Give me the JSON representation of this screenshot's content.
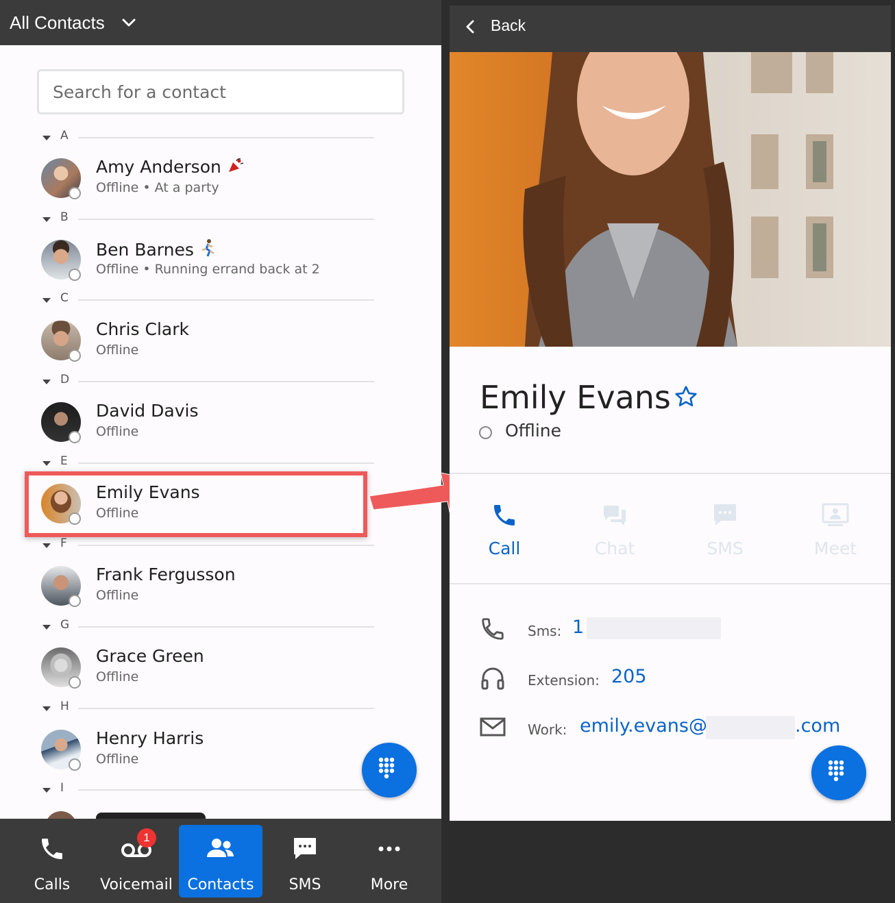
{
  "left_header": {
    "title": "All Contacts"
  },
  "search": {
    "placeholder": "Search for a contact"
  },
  "sections": [
    "A",
    "B",
    "C",
    "D",
    "E",
    "F",
    "G",
    "H",
    "I"
  ],
  "contacts": [
    {
      "name": "Amy Anderson",
      "status": "Offline • At a party",
      "emoji": "party-popper-emoji"
    },
    {
      "name": "Ben Barnes",
      "status": "Offline • Running errand back at 2",
      "emoji": "runner-emoji"
    },
    {
      "name": "Chris Clark",
      "status": "Offline"
    },
    {
      "name": "David Davis",
      "status": "Offline"
    },
    {
      "name": "Emily Evans",
      "status": "Offline"
    },
    {
      "name": "Frank Fergusson",
      "status": "Offline"
    },
    {
      "name": "Grace Green",
      "status": "Offline"
    },
    {
      "name": "Henry Harris",
      "status": "Offline"
    }
  ],
  "bottom_nav": [
    {
      "label": "Calls",
      "icon": "phone-icon"
    },
    {
      "label": "Voicemail",
      "icon": "voicemail-icon",
      "badge": "1"
    },
    {
      "label": "Contacts",
      "icon": "contacts-icon",
      "active": true
    },
    {
      "label": "SMS",
      "icon": "sms-icon"
    },
    {
      "label": "More",
      "icon": "more-icon"
    }
  ],
  "right_header": {
    "back_label": "Back"
  },
  "detail": {
    "name": "Emily Evans",
    "status": "Offline",
    "actions": [
      {
        "label": "Call",
        "enabled": true
      },
      {
        "label": "Chat",
        "enabled": false
      },
      {
        "label": "SMS",
        "enabled": false
      },
      {
        "label": "Meet",
        "enabled": false
      }
    ],
    "sms": {
      "label": "Sms:",
      "value": "1"
    },
    "extension": {
      "label": "Extension:",
      "value": "205"
    },
    "work": {
      "label": "Work:",
      "value_prefix": "emily.evans@",
      "value_suffix": ".com"
    }
  },
  "colors": {
    "accent": "#0b70e0",
    "highlight": "#ee5a5a",
    "header": "#3b3b3b"
  }
}
